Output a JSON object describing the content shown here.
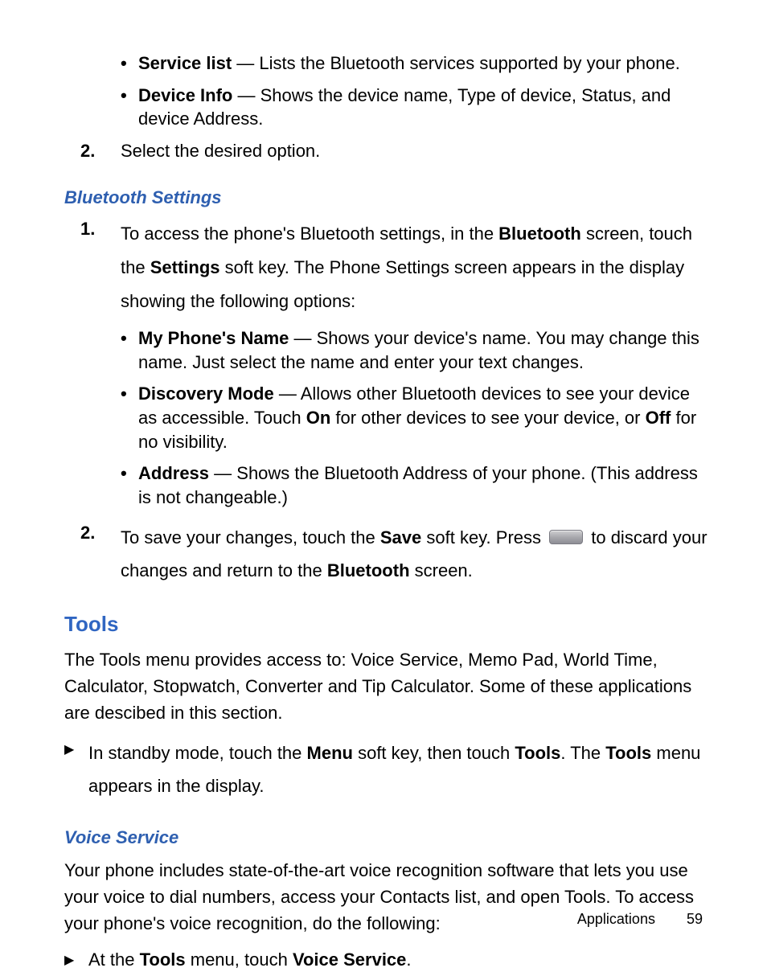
{
  "intro_bullets": [
    {
      "label": "Service list",
      "desc": " — Lists the Bluetooth services supported by your phone."
    },
    {
      "label": "Device Info",
      "desc": " — Shows the device name, Type of device, Status, and device Address."
    }
  ],
  "intro_step2_marker": "2.",
  "intro_step2_text": "Select the desired option.",
  "bt_heading": "Bluetooth Settings",
  "bt_step1_marker": "1.",
  "bt_step1_pre": "To access the phone's Bluetooth settings, in the ",
  "bt_step1_b1": "Bluetooth",
  "bt_step1_mid1": " screen, touch the ",
  "bt_step1_b2": "Settings",
  "bt_step1_tail": " soft key. The Phone Settings screen appears in the display showing the following options:",
  "bt_bullets": [
    {
      "label": "My Phone's Name",
      "desc_pre": " — Shows your device's name. You may change this name. Just select the name and enter your text changes."
    },
    {
      "label": "Discovery Mode",
      "desc_pre": " — Allows other Bluetooth devices to see your device as accessible. Touch ",
      "b1": "On",
      "mid": " for other devices to see your device, or ",
      "b2": "Off",
      "tail": " for no visibility."
    },
    {
      "label": "Address",
      "desc_pre": " — Shows the Bluetooth Address of your phone. (This address is not changeable.)"
    }
  ],
  "bt_step2_marker": "2.",
  "bt_step2_pre": "To save your changes, touch the ",
  "bt_step2_b1": "Save",
  "bt_step2_mid1": " soft key. Press ",
  "bt_step2_mid2": " to discard your changes and return to the ",
  "bt_step2_b2": "Bluetooth",
  "bt_step2_tail": " screen.",
  "tools_heading": "Tools",
  "tools_para": "The Tools menu provides access to: Voice Service, Memo Pad, World Time, Calculator, Stopwatch, Converter and Tip Calculator. Some of these applications are descibed in this section.",
  "tools_arrow_pre": "In standby mode, touch the ",
  "tools_arrow_b1": "Menu",
  "tools_arrow_mid1": " soft key, then touch ",
  "tools_arrow_b2": "Tools",
  "tools_arrow_mid2": ". The ",
  "tools_arrow_b3": "Tools",
  "tools_arrow_tail": " menu appears in the display.",
  "vs_heading": "Voice Service",
  "vs_para": "Your phone includes state-of-the-art voice recognition software that lets you use your voice to dial numbers, access your Contacts list, and open Tools. To access your phone's voice recognition, do the following:",
  "vs_arrow_pre": "At the ",
  "vs_arrow_b1": "Tools",
  "vs_arrow_mid": " menu, touch ",
  "vs_arrow_b2": "Voice Service",
  "vs_arrow_tail": ".",
  "footer_label": "Applications",
  "footer_page": "59"
}
